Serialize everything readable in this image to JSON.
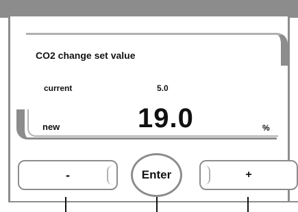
{
  "screen": {
    "title": "CO2 change set value",
    "current_label": "current",
    "current_value": "5.0",
    "new_label": "new",
    "new_value": "19.0",
    "unit": "%"
  },
  "buttons": {
    "minus_label": "-",
    "enter_label": "Enter",
    "plus_label": "+"
  },
  "colors": {
    "frame": "#8c8c8c",
    "text": "#111111",
    "background": "#ffffff"
  }
}
